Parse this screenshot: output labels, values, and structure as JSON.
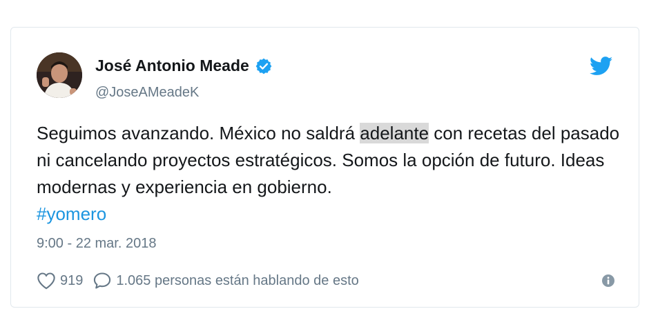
{
  "author": {
    "name": "José Antonio Meade",
    "handle": "@JoseAMeadeK"
  },
  "tweet": {
    "text_before": "Seguimos avanzando. México no saldrá ",
    "highlighted": "adelante",
    "text_after": " con recetas del pasado ni cancelando proyectos estratégicos. Somos la opción de futuro. Ideas modernas y experiencia en gobierno.",
    "hashtag": "#yomero",
    "timestamp": "9:00 - 22 mar. 2018"
  },
  "actions": {
    "likes": "919",
    "conversation": "1.065 personas están hablando de esto"
  },
  "colors": {
    "link": "#1b95e0",
    "muted": "#657786",
    "verified": "#1da1f2"
  },
  "icons": {
    "verified": "verified-badge-icon",
    "brand": "twitter-bird-icon",
    "like": "heart-icon",
    "reply": "speech-bubble-icon",
    "info": "info-icon"
  }
}
